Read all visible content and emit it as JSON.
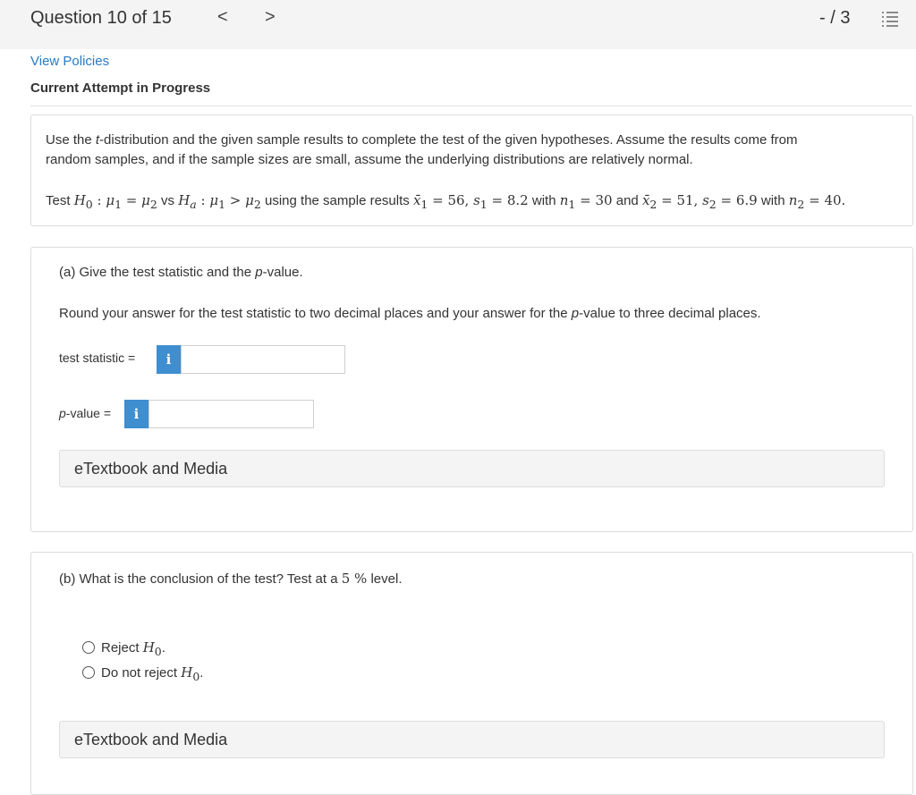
{
  "header": {
    "question_label": "Question 10 of 15",
    "prev_glyph": "<",
    "next_glyph": ">",
    "score": "- / 3",
    "list_icon": "list-icon"
  },
  "policies_link": "View Policies",
  "attempt_label": "Current Attempt in Progress",
  "stem": {
    "text_line1_pre": "Use the ",
    "text_line1_t": "t",
    "text_line1_post": "-distribution and the given sample results to complete the test of the given hypotheses. Assume the results come from",
    "text_line2": "random samples, and if the sample sizes are small, assume the underlying distributions are relatively normal.",
    "hyp": {
      "test": "Test",
      "h0": "H",
      "h0_sub": "0",
      "colon": " : ",
      "mu": "μ",
      "sub1": "1",
      "sub2": "2",
      "eq": " = ",
      "vs": " vs ",
      "ha_sub": "a",
      "gt": " > ",
      "using": " using the sample results ",
      "xbar": "x̄",
      "x1_val": " = 56, ",
      "s": "s",
      "s1_val": " = 8.2",
      "with": " with ",
      "n": "n",
      "n1_val": " = 30",
      "and": " and ",
      "x2_val": " = 51, ",
      "s2_val": " = 6.9",
      "n2_val": " = 40."
    }
  },
  "part_a": {
    "prompt_pre": "(a) Give the test statistic and the ",
    "prompt_p": "p",
    "prompt_post": "-value.",
    "round_pre": "Round your answer for the test statistic to two decimal places and your answer for the ",
    "round_p": "p",
    "round_post": "-value to three decimal places.",
    "test_stat_label": "test statistic =",
    "pvalue_p": "p",
    "pvalue_label": "-value =",
    "info_glyph": "i",
    "test_stat_value": "",
    "pvalue_value": "",
    "media_label": "eTextbook and Media"
  },
  "part_b": {
    "prompt_pre": "(b) What is the conclusion of the test? Test at a ",
    "prompt_level": "5 %",
    "prompt_post": " level.",
    "options": [
      {
        "text": "Reject ",
        "h": "H",
        "sub": "0",
        "end": "."
      },
      {
        "text": "Do not reject ",
        "h": "H",
        "sub": "0",
        "end": "."
      }
    ],
    "media_label": "eTextbook and Media"
  }
}
